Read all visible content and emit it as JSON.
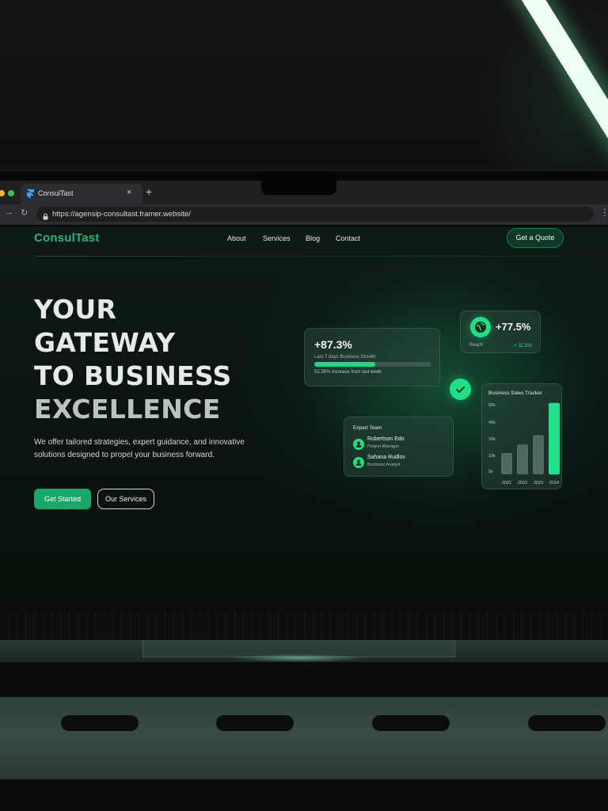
{
  "browser": {
    "tab_title": "ConsulTast",
    "tab_close": "×",
    "new_tab": "+",
    "url": "https://agensip-consultast.framer.website/",
    "menu": "⋮"
  },
  "site": {
    "logo": "ConsulTast",
    "nav": [
      "About",
      "Services",
      "Blog",
      "Contact"
    ],
    "quote_button": "Get a Quote",
    "hero": {
      "title_lines": [
        "YOUR",
        "GATEWAY",
        "TO BUSINESS",
        "EXCELLENCE"
      ],
      "subtitle": "We offer tailored strategies, expert guidance, and innovative solutions designed to propel your business forward.",
      "primary_button": "Get Started",
      "secondary_button": "Our Services"
    },
    "growth_card": {
      "value": "+87.3%",
      "label": "Last 7 days Business Growth",
      "progress": 0.52,
      "note": "52.35% increase from last week"
    },
    "reach_card": {
      "value": "+77.5%",
      "label": "Reach",
      "delta": "↗ 32.5%"
    },
    "team_card": {
      "title": "Expert Team",
      "members": [
        {
          "name": "Robertson Edo",
          "role": "Project Manager"
        },
        {
          "name": "Sahana Rudlov",
          "role": "Business Analyst"
        }
      ]
    },
    "sales_card": {
      "title": "Business Sales Tracker"
    }
  },
  "colors": {
    "accent": "#1ee085",
    "brand": "#1fb878",
    "button_primary": "#18a96a"
  },
  "chart_data": {
    "type": "bar",
    "title": "Business Sales Tracker",
    "categories": [
      "2021",
      "2022",
      "2023",
      "2024"
    ],
    "values": [
      18,
      25,
      33,
      60
    ],
    "yticks": [
      "60k",
      "40k",
      "20k",
      "10k",
      "5k"
    ],
    "ylim": [
      0,
      60
    ],
    "highlight": "2024"
  }
}
